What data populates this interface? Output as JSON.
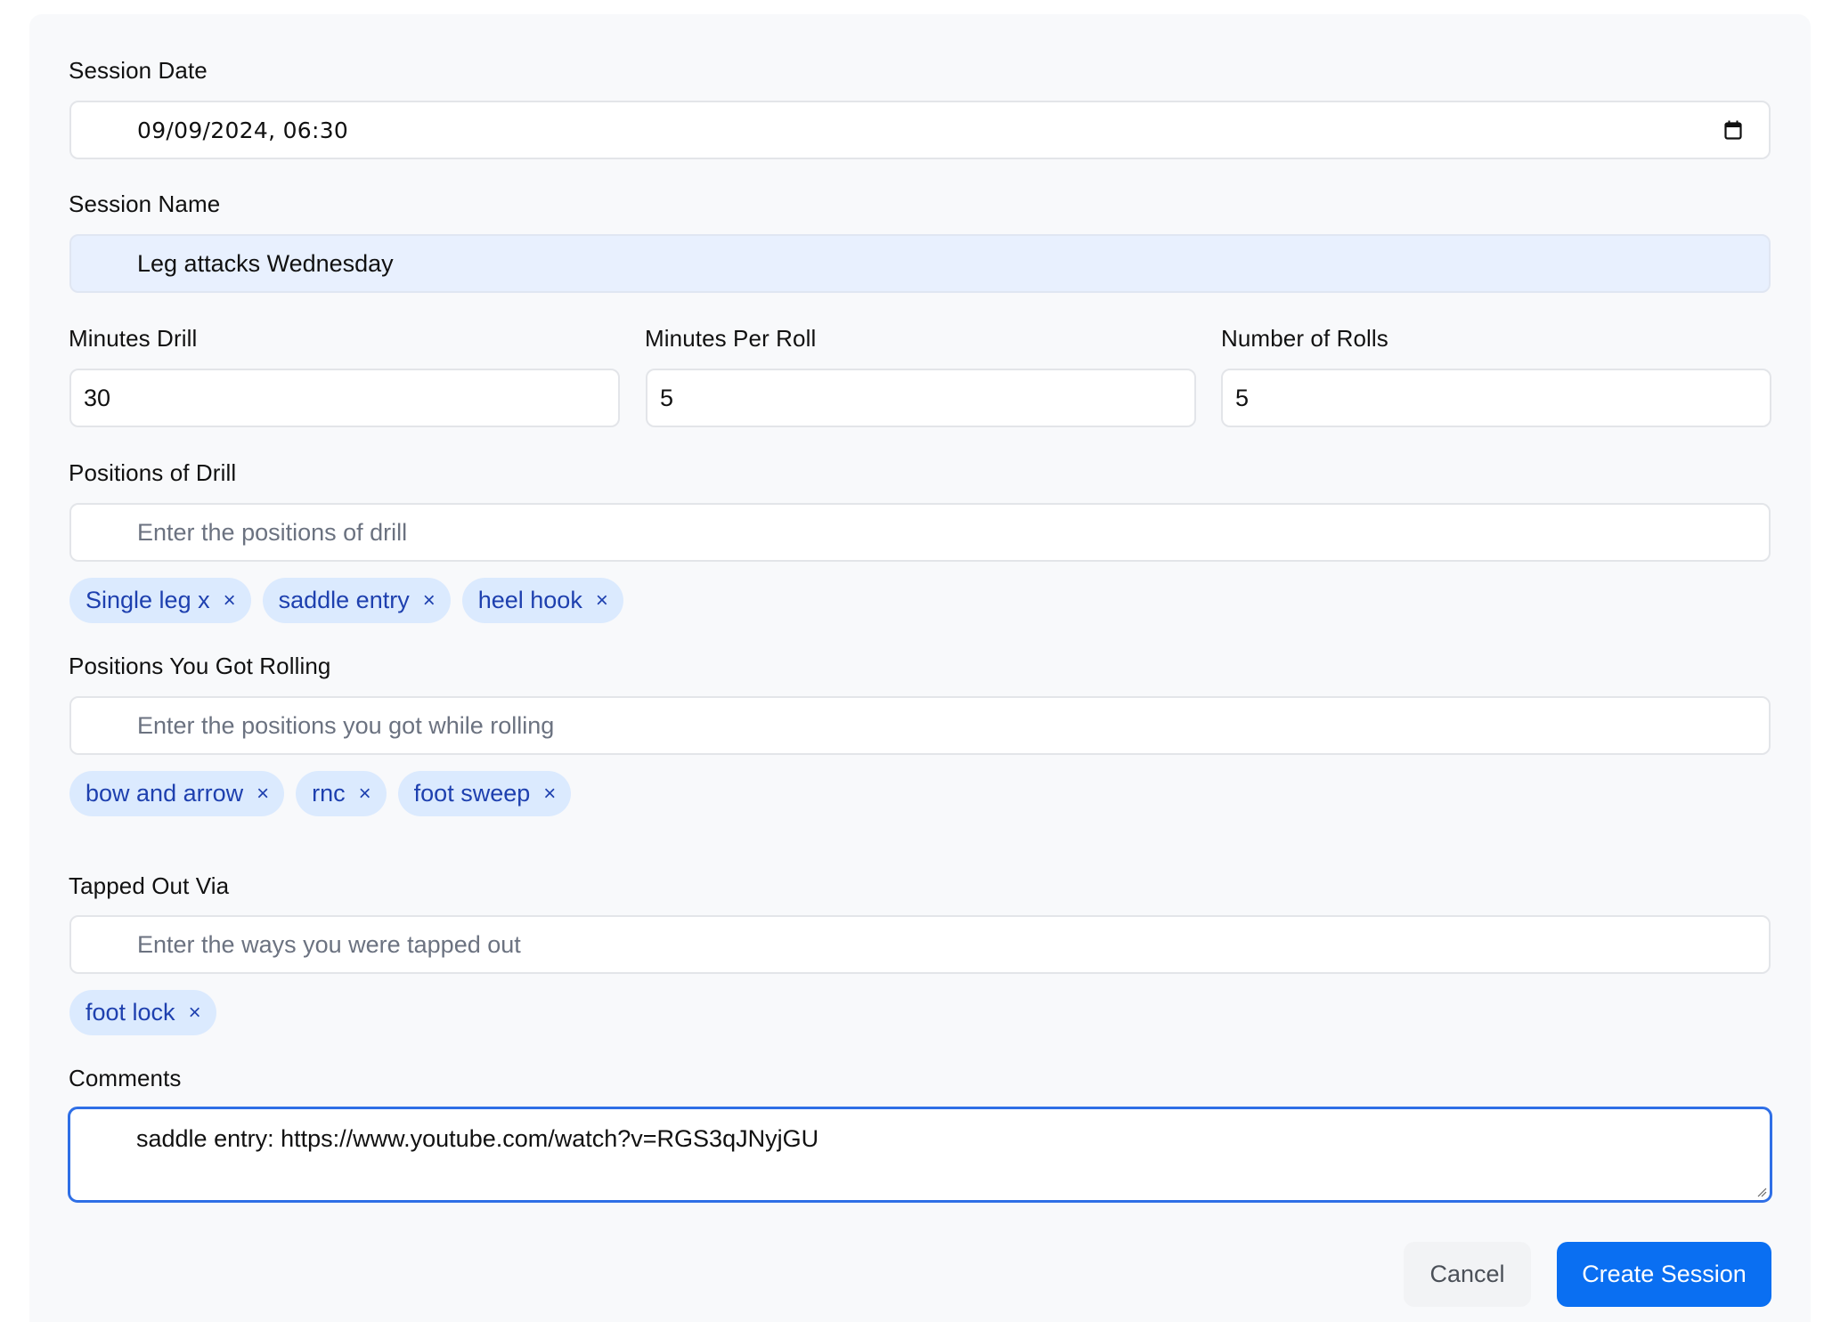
{
  "form": {
    "session_date": {
      "label": "Session Date",
      "value": "09/09/2024, 06:30",
      "icon": "calendar-icon"
    },
    "session_name": {
      "label": "Session Name",
      "value": "Leg attacks Wednesday"
    },
    "minutes_drill": {
      "label": "Minutes Drill",
      "value": "30"
    },
    "minutes_per_roll": {
      "label": "Minutes Per Roll",
      "value": "5"
    },
    "number_of_rolls": {
      "label": "Number of Rolls",
      "value": "5"
    },
    "positions_of_drill": {
      "label": "Positions of Drill",
      "placeholder": "Enter the positions of drill",
      "tags": [
        "Single leg x",
        "saddle entry",
        "heel hook"
      ]
    },
    "positions_rolling": {
      "label": "Positions You Got Rolling",
      "placeholder": "Enter the positions you got while rolling",
      "tags": [
        "bow and arrow",
        "rnc",
        "foot sweep"
      ]
    },
    "tapped_out_via": {
      "label": "Tapped Out Via",
      "placeholder": "Enter the ways you were tapped out",
      "tags": [
        "foot lock"
      ]
    },
    "comments": {
      "label": "Comments",
      "value": "saddle entry: https://www.youtube.com/watch?v=RGS3qJNyjGU"
    }
  },
  "tag_remove_glyph": "×",
  "actions": {
    "cancel_label": "Cancel",
    "create_label": "Create Session"
  },
  "colors": {
    "primary": "#0a6ff2",
    "focus_border": "#2f6fe6",
    "chip_bg": "#dbeafe",
    "chip_text": "#1e40af",
    "autofill_bg": "#e8f0fe",
    "placeholder": "#6b7280"
  }
}
